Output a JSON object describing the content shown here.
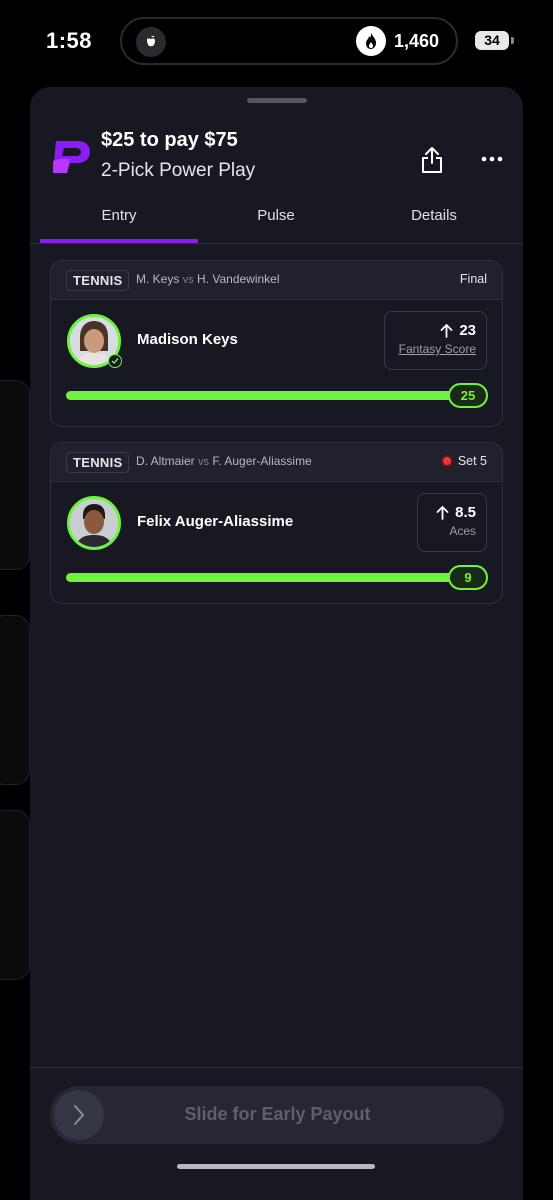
{
  "status_bar": {
    "time": "1:58",
    "island_count": "1,460",
    "battery": "34"
  },
  "entry": {
    "title": "$25 to pay $75",
    "subtitle": "2-Pick Power Play"
  },
  "tabs": [
    {
      "label": "Entry",
      "active": true
    },
    {
      "label": "Pulse",
      "active": false
    },
    {
      "label": "Details",
      "active": false
    }
  ],
  "picks": [
    {
      "sport": "TENNIS",
      "player_a": "M. Keys",
      "vs": "vs",
      "player_b": "H. Vandewinkel",
      "status": "Final",
      "live": false,
      "player": "Madison Keys",
      "line": "23",
      "direction": "up",
      "stat": "Fantasy Score",
      "result": "25",
      "progress": 1.0
    },
    {
      "sport": "TENNIS",
      "player_a": "D. Altmaier",
      "vs": "vs",
      "player_b": "F. Auger-Aliassime",
      "status": "Set 5",
      "live": true,
      "player": "Felix Auger-Aliassime",
      "line": "8.5",
      "direction": "up",
      "stat": "Aces",
      "result": "9",
      "progress": 1.0
    }
  ],
  "slider": {
    "label": "Slide for Early Payout"
  },
  "colors": {
    "accent_purple": "#8b1cf5",
    "progress_green": "#6df53e",
    "live_red": "#ff2e3a"
  }
}
